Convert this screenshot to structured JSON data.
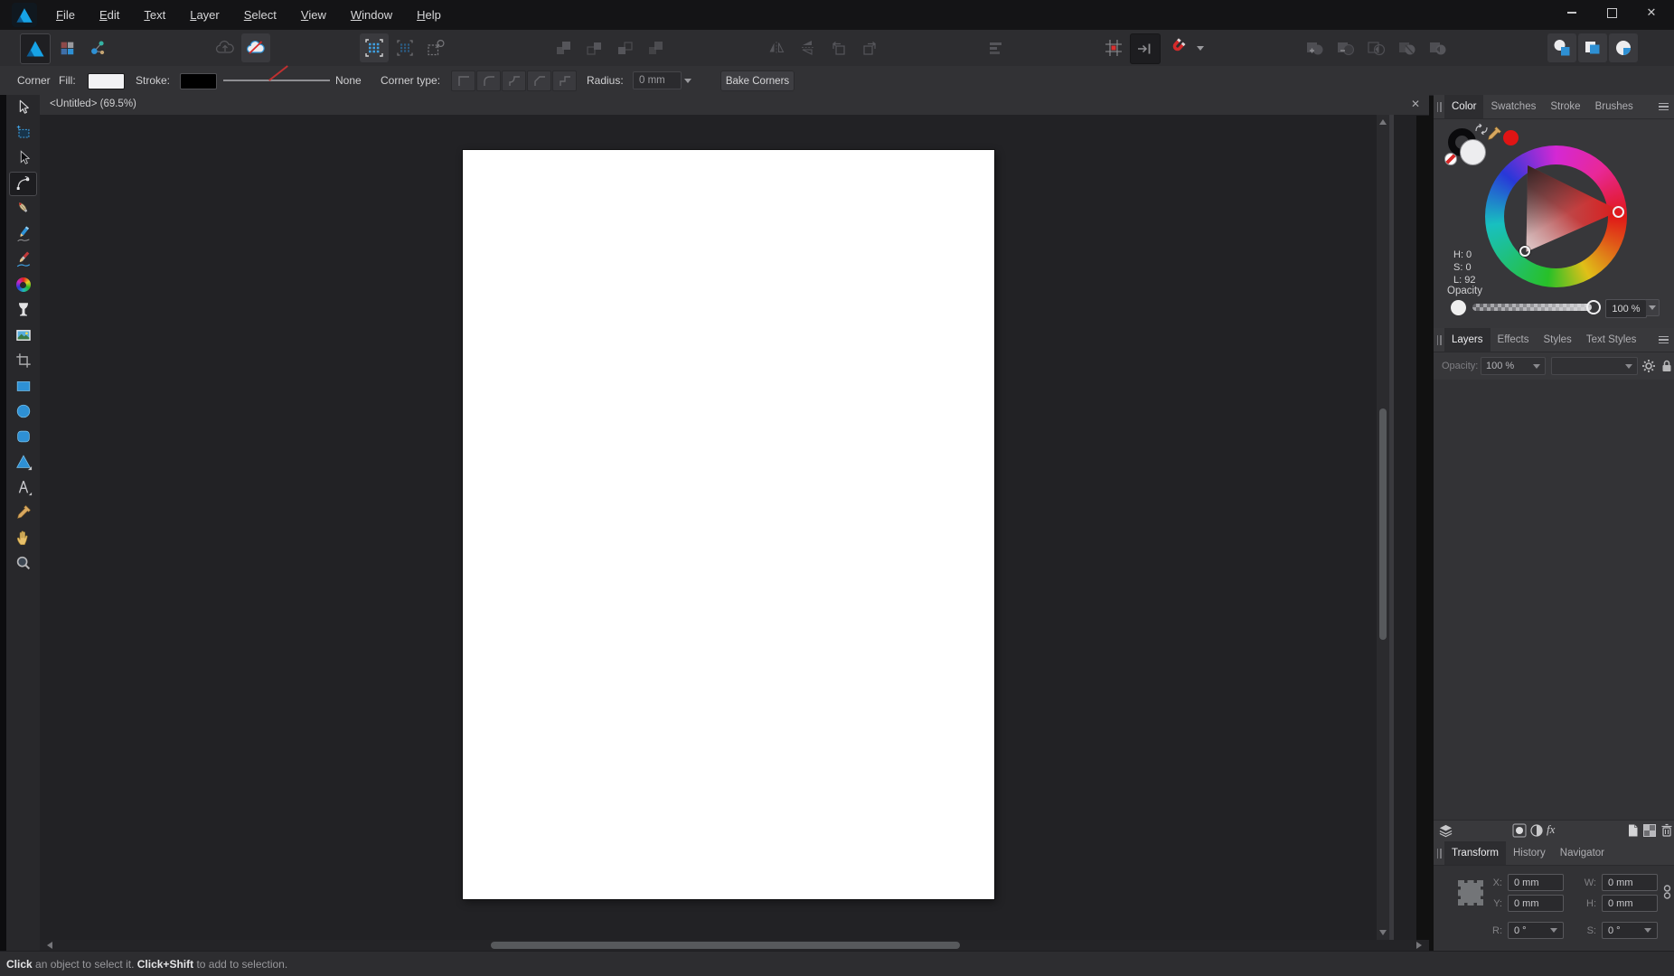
{
  "menubar": {
    "items": [
      "File",
      "Edit",
      "Text",
      "Layer",
      "Select",
      "View",
      "Window",
      "Help"
    ]
  },
  "context_toolbar": {
    "tool_name": "Corner",
    "fill_label": "Fill:",
    "stroke_label": "Stroke:",
    "stroke_style": "None",
    "corner_type_label": "Corner type:",
    "radius_label": "Radius:",
    "radius_value": "0 mm",
    "bake_corners_button": "Bake Corners"
  },
  "document": {
    "tab_title": "<Untitled> (69.5%)"
  },
  "left_toolbar": {
    "selected_tool": "corner-tool",
    "tools": [
      "move-tool",
      "artboard-tool",
      "node-tool",
      "corner-tool",
      "pen-tool",
      "pencil-tool",
      "vector-brush-tool",
      "fill-tool",
      "transparency-tool",
      "place-image-tool",
      "vector-crop-tool",
      "rectangle-tool",
      "ellipse-tool",
      "rounded-rectangle-tool",
      "triangle-tool",
      "artistic-text-tool",
      "color-picker-tool",
      "view-tool",
      "zoom-tool"
    ]
  },
  "color_panel": {
    "tabs": [
      "Color",
      "Swatches",
      "Stroke",
      "Brushes"
    ],
    "active_tab": "Color",
    "readouts": {
      "h": "H: 0",
      "s": "S: 0",
      "l": "L: 92"
    },
    "opacity_label": "Opacity",
    "opacity_value": "100 %"
  },
  "layers_panel": {
    "tabs": [
      "Layers",
      "Effects",
      "Styles",
      "Text Styles"
    ],
    "active_tab": "Layers",
    "opacity_label": "Opacity:",
    "opacity_value": "100 %",
    "fx_icon_label": "fx"
  },
  "transform_panel": {
    "tabs": [
      "Transform",
      "History",
      "Navigator"
    ],
    "active_tab": "Transform",
    "x_label": "X:",
    "x_value": "0 mm",
    "y_label": "Y:",
    "y_value": "0 mm",
    "w_label": "W:",
    "w_value": "0 mm",
    "h_label": "H:",
    "h_value": "0 mm",
    "r_label": "R:",
    "r_value": "0 °",
    "s_label": "S:",
    "s_value": "0 °"
  },
  "status_bar": {
    "parts": [
      {
        "text": "Click",
        "bold": true
      },
      {
        "text": " an object to select it. ",
        "bold": false
      },
      {
        "text": "Click+Shift",
        "bold": true
      },
      {
        "text": " to add to selection.",
        "bold": false
      }
    ]
  },
  "colors": {
    "accent_blue": "#2e90d4",
    "magnet_red": "#d42a2a",
    "selection_red": "#e01414",
    "canvas_bg": "#222225",
    "panel_bg": "#37373a",
    "page": "#ffffff"
  }
}
